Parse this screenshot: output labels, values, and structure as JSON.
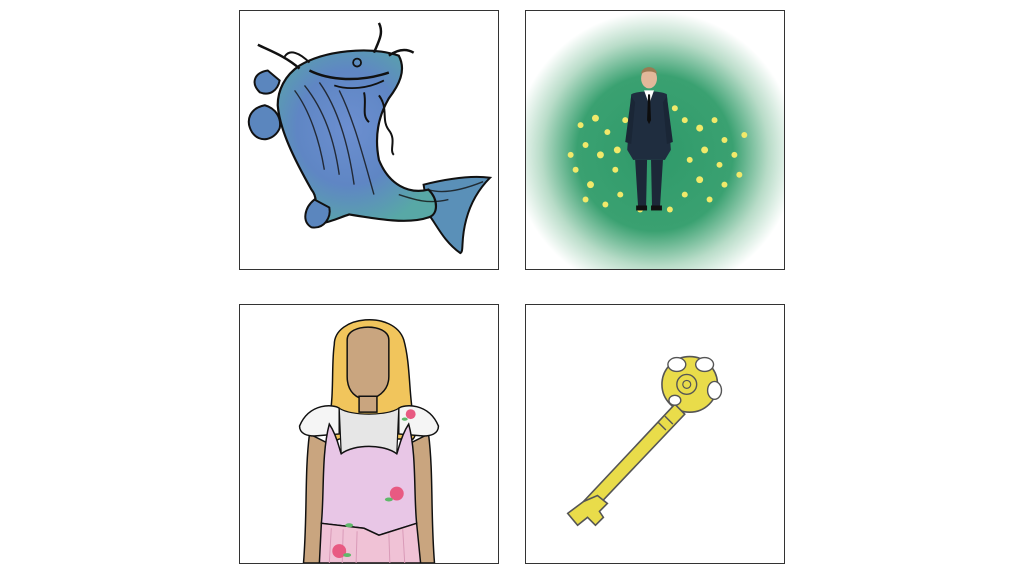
{
  "panels": [
    {
      "id": "fish",
      "icon": "catfish-icon"
    },
    {
      "id": "man",
      "icon": "man-in-suit-icon"
    },
    {
      "id": "girl",
      "icon": "girl-in-dress-icon"
    },
    {
      "id": "key",
      "icon": "skeleton-key-icon"
    }
  ],
  "colors": {
    "border": "#333333",
    "fish_blue": "#5f86c4",
    "fish_teal": "#58a8a6",
    "meadow_green": "#2f9a6a",
    "flower_yellow": "#f1e96a",
    "suit_navy": "#1f2d3f",
    "hair_blonde": "#f1c55c",
    "skin": "#c9a57f",
    "dress_pink": "#e8c6e6",
    "key_gold": "#e9dc4a"
  }
}
